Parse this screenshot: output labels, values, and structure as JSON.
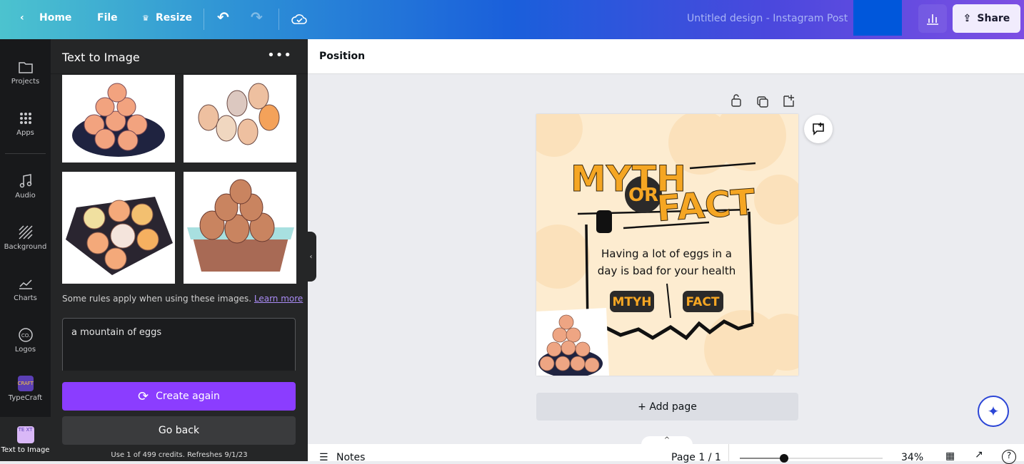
{
  "topbar": {
    "home": "Home",
    "file": "File",
    "resize": "Resize",
    "title": "Untitled design - Instagram Post",
    "share": "Share"
  },
  "rail": [
    {
      "label": "Projects",
      "icon": "folder-icon"
    },
    {
      "label": "Apps",
      "icon": "apps-grid-icon"
    },
    {
      "label": "Audio",
      "icon": "music-note-icon"
    },
    {
      "label": "Background",
      "icon": "background-hatch-icon"
    },
    {
      "label": "Charts",
      "icon": "chart-line-icon"
    },
    {
      "label": "Logos",
      "icon": "logo-co-icon"
    },
    {
      "label": "TypeCraft",
      "icon": "typecraft-app-icon"
    },
    {
      "label": "Text to Image",
      "icon": "text-to-image-app-icon"
    }
  ],
  "panel": {
    "title": "Text to Image",
    "rules": "Some rules apply when using these images.",
    "learn_more": "Learn more",
    "prompt": "a mountain of eggs",
    "create_again": "Create again",
    "go_back": "Go back",
    "credits": "Use 1 of 499 credits. Refreshes 9/1/23"
  },
  "toolbar": {
    "position": "Position"
  },
  "design": {
    "myth": "MYTH",
    "or": "OR",
    "fact": "FACT",
    "statement": "Having a lot of eggs in a day is bad for your health",
    "option1": "MTYH",
    "option2": "FACT",
    "accent": "#f5a623"
  },
  "canvas": {
    "add_page": "+ Add page"
  },
  "footer": {
    "notes": "Notes",
    "page": "Page 1 / 1",
    "zoom": "34%",
    "zoom_value": 34
  }
}
